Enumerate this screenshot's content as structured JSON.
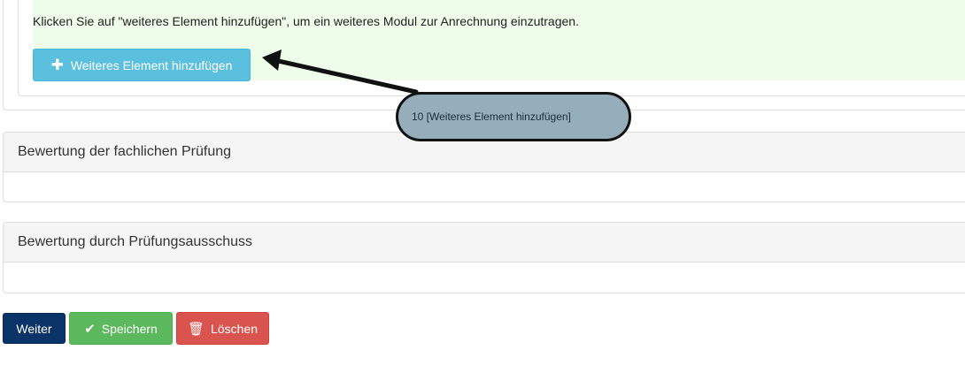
{
  "info": {
    "text": "Klicken Sie auf \"weiteres Element hinzufügen\", um ein weiteres Modul zur Anrechnung einzutragen.",
    "add_button": {
      "icon": "plus-icon",
      "label": "Weiteres Element hinzufügen"
    }
  },
  "sections": [
    {
      "title": "Bewertung der fachlichen Prüfung"
    },
    {
      "title": "Bewertung durch Prüfungsausschuss"
    }
  ],
  "actions": {
    "next_label": "Weiter",
    "save": {
      "icon": "checkmark-icon",
      "label": "Speichern"
    },
    "delete": {
      "icon": "trash-icon",
      "label": "Löschen"
    }
  },
  "annotation": {
    "text": "10 [Weiteres Element hinzufügen]"
  },
  "colors": {
    "info_bg": "#edfdea",
    "add_button": "#5bc0de",
    "next_button": "#0a3468",
    "save_button": "#5cb85c",
    "delete_button": "#d9534f",
    "callout_bg": "#96aeb9"
  }
}
